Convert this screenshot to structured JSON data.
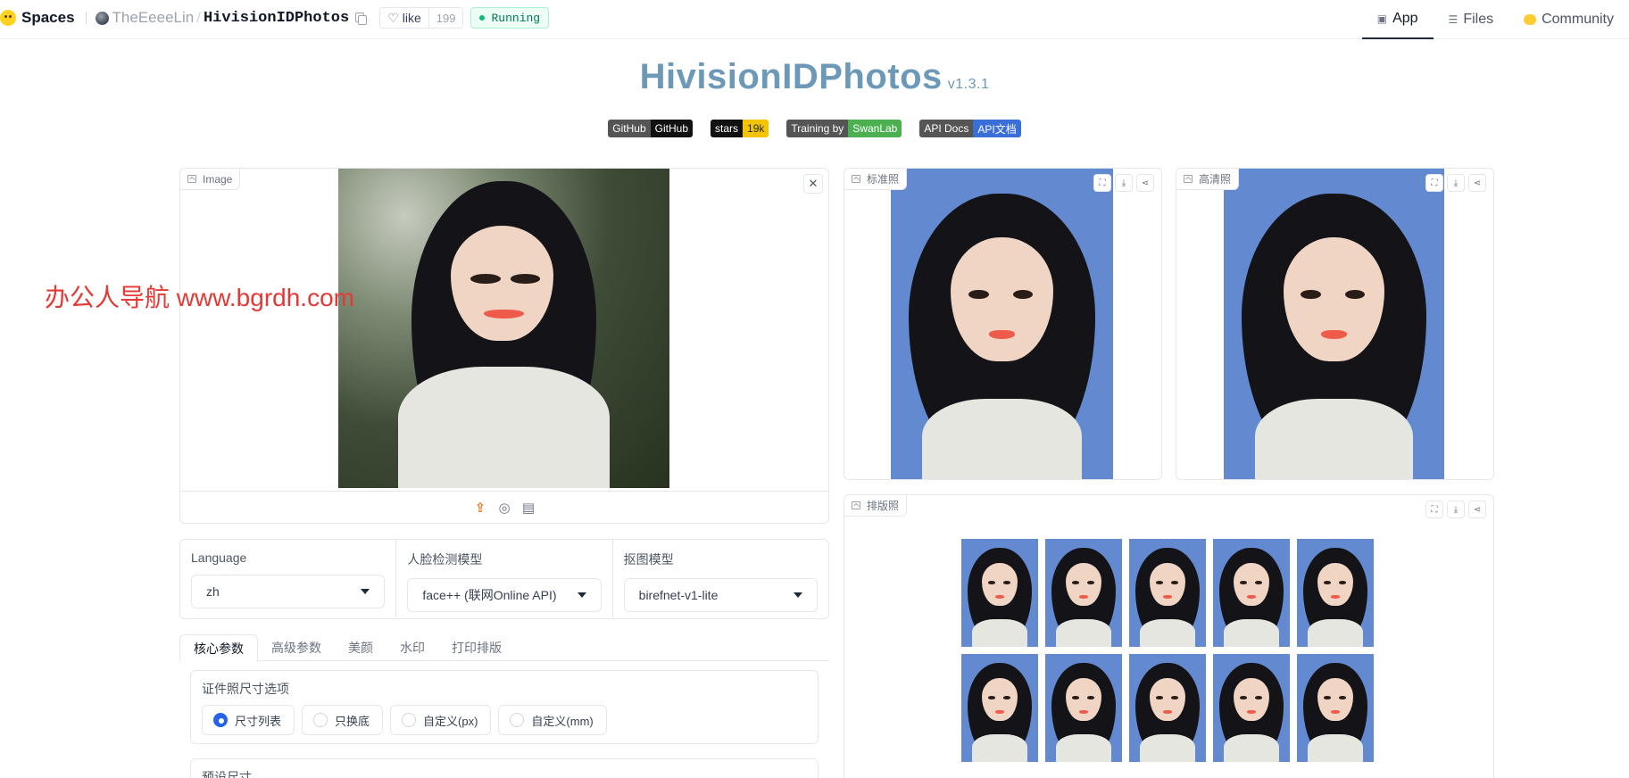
{
  "topbar": {
    "spaces_label": "Spaces",
    "owner": "TheEeeeLin",
    "repo": "HivisionIDPhotos",
    "like_label": "like",
    "like_count": "199",
    "status": "Running",
    "tabs": [
      {
        "label": "App",
        "icon": "cube-icon",
        "active": true
      },
      {
        "label": "Files",
        "icon": "files-icon",
        "active": false
      },
      {
        "label": "Community",
        "icon": "community-icon",
        "active": false
      }
    ]
  },
  "header": {
    "title": "HivisionIDPhotos",
    "version": "v1.3.1",
    "badges": [
      {
        "left": "GitHub",
        "right": "GitHub",
        "right_color": "#111111"
      },
      {
        "left": "stars",
        "right": "19k",
        "right_color": "#f5c400"
      },
      {
        "left": "Training by",
        "right": "SwanLab",
        "right_color": "#4caf50"
      },
      {
        "left": "API Docs",
        "right": "API文档",
        "right_color": "#3a6fd8"
      }
    ]
  },
  "input_image": {
    "label": "Image"
  },
  "outputs": {
    "standard_label": "标准照",
    "hd_label": "高清照",
    "layout_label": "排版照",
    "bg_color": "#638ad0"
  },
  "dropdowns": [
    {
      "label": "Language",
      "value": "zh"
    },
    {
      "label": "人脸检测模型",
      "value": "face++ (联网Online API)"
    },
    {
      "label": "抠图模型",
      "value": "birefnet-v1-lite"
    }
  ],
  "tabs": [
    "核心参数",
    "高级参数",
    "美颜",
    "水印",
    "打印排版"
  ],
  "size_options": {
    "title": "证件照尺寸选项",
    "options": [
      "尺寸列表",
      "只换底",
      "自定义(px)",
      "自定义(mm)"
    ],
    "selected": 0
  },
  "preset": {
    "title": "预设尺寸"
  },
  "watermark_text": "办公人导航 www.bgrdh.com"
}
